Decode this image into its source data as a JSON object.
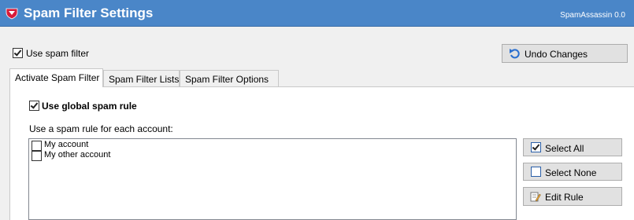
{
  "window": {
    "title": "Spam Filter Settings",
    "version": "SpamAssassin 0.0",
    "accent": "#4a86c8"
  },
  "top": {
    "use_spam_filter_label": "Use spam filter",
    "use_spam_filter_checked": true,
    "undo_label": "Undo Changes"
  },
  "tabs": [
    {
      "label": "Activate Spam Filter",
      "active": true
    },
    {
      "label": "Spam Filter Lists",
      "active": false
    },
    {
      "label": "Spam Filter Options",
      "active": false
    }
  ],
  "panel": {
    "global_rule_label": "Use global spam rule",
    "global_rule_checked": true,
    "per_account_label": "Use a spam rule for each account:",
    "accounts": [
      {
        "label": "My account",
        "checked": false
      },
      {
        "label": "My other account",
        "checked": false
      }
    ],
    "buttons": {
      "select_all": "Select All",
      "select_none": "Select None",
      "edit_rule": "Edit Rule"
    }
  }
}
